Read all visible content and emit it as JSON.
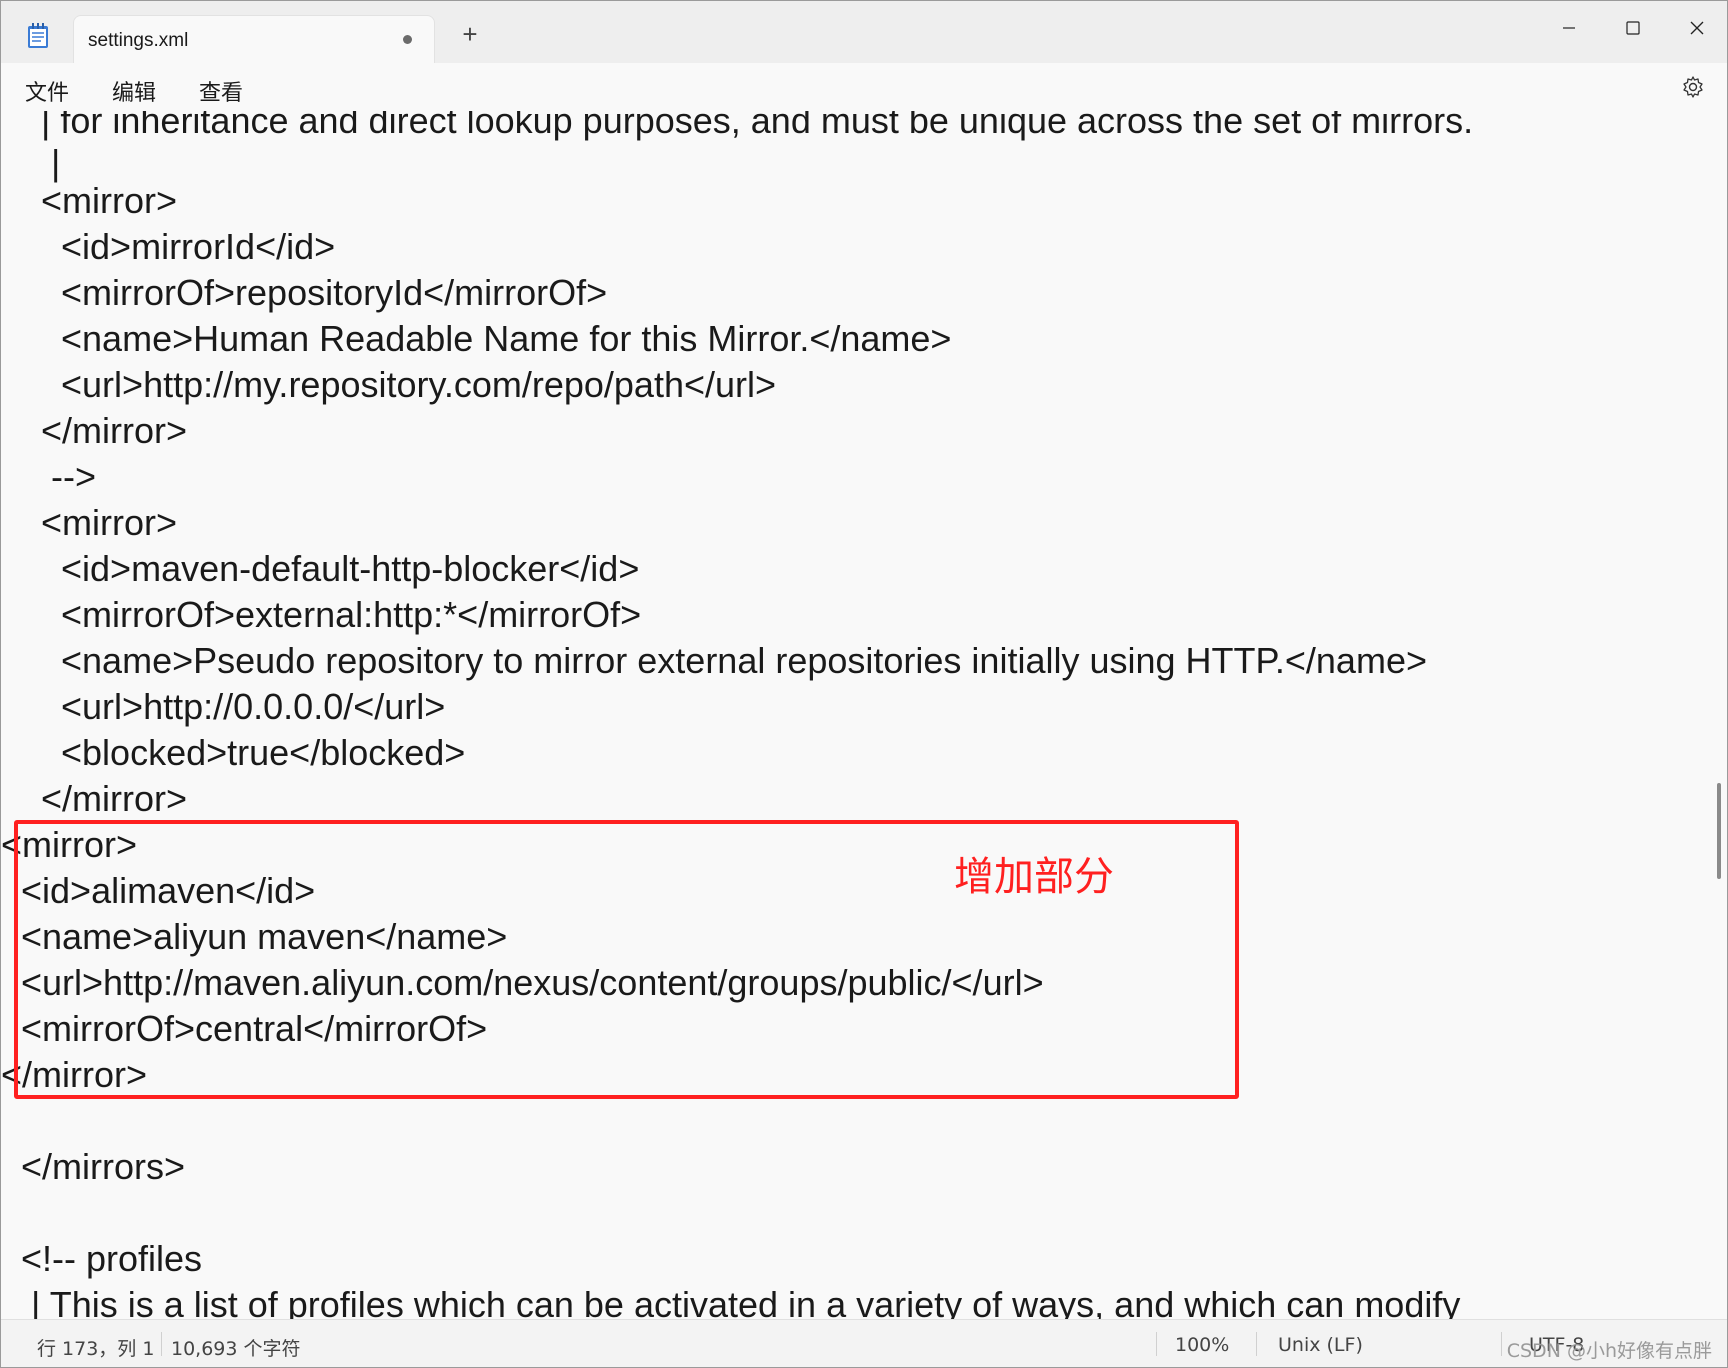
{
  "tab": {
    "title": "settings.xml"
  },
  "menu": [
    "文件",
    "编辑",
    "查看"
  ],
  "code_lines": [
    "    | for inheritance and direct lookup purposes, and must be unique across the set of mirrors.",
    "     |",
    "    <mirror>",
    "      <id>mirrorId</id>",
    "      <mirrorOf>repositoryId</mirrorOf>",
    "      <name>Human Readable Name for this Mirror.</name>",
    "      <url>http://my.repository.com/repo/path</url>",
    "    </mirror>",
    "     -->",
    "    <mirror>",
    "      <id>maven-default-http-blocker</id>",
    "      <mirrorOf>external:http:*</mirrorOf>",
    "      <name>Pseudo repository to mirror external repositories initially using HTTP.</name>",
    "      <url>http://0.0.0.0/</url>",
    "      <blocked>true</blocked>",
    "    </mirror>",
    "<mirror>",
    "  <id>alimaven</id>",
    "  <name>aliyun maven</name>",
    "  <url>http://maven.aliyun.com/nexus/content/groups/public/</url>",
    "  <mirrorOf>central</mirrorOf>",
    "</mirror>",
    "",
    "  </mirrors>",
    "",
    "  <!-- profiles",
    "   | This is a list of profiles which can be activated in a variety of ways, and which can modify"
  ],
  "annotation": "增加部分",
  "status": {
    "position": "行 173，列 1",
    "chars": "10,693 个字符",
    "zoom": "100%",
    "line_ending": "Unix (LF)",
    "encoding": "UTF-8"
  },
  "watermark": "CSDN @小h好像有点胖",
  "colors": {
    "highlight": "#ff2020"
  }
}
